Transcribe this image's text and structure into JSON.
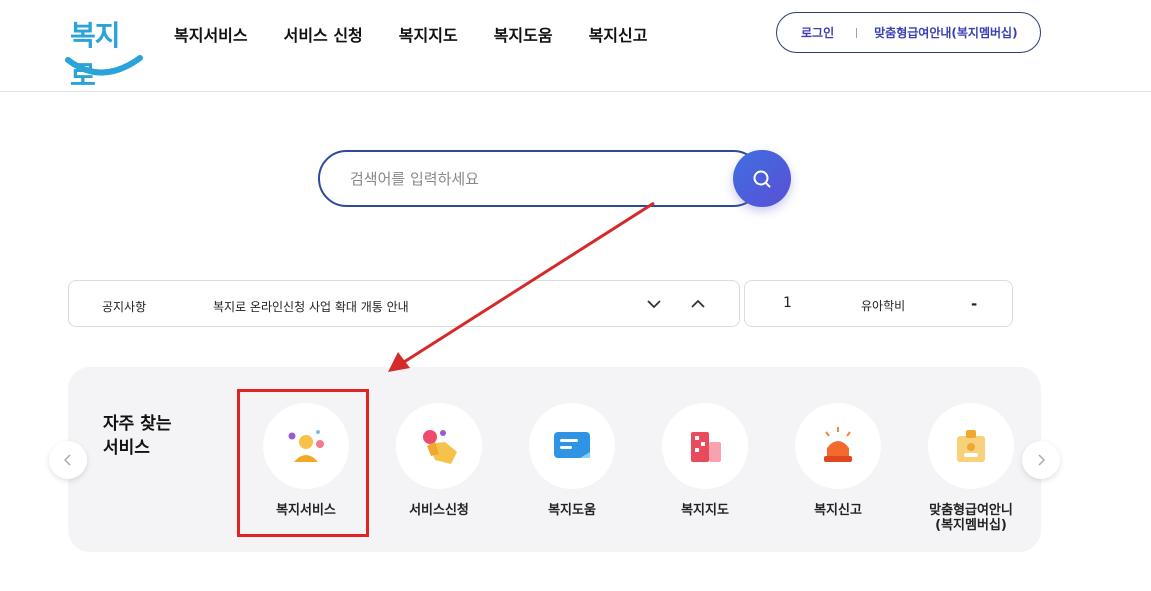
{
  "header": {
    "logo_text": "복지로",
    "nav": [
      "복지서비스",
      "서비스 신청",
      "복지지도",
      "복지도움",
      "복지신고"
    ],
    "login_label": "로그인",
    "member_label": "맞춤형급여안내(복지멤버십)"
  },
  "search": {
    "placeholder": "검색어를 입력하세요"
  },
  "notice": {
    "label": "공지사항",
    "text": "복지로 온라인신청 사업 확대 개통 안내"
  },
  "ranking": {
    "rank": "1",
    "term": "유아학비",
    "change": "-"
  },
  "frequent": {
    "title_line1": "자주 찾는",
    "title_line2": "서비스",
    "items": [
      {
        "label": "복지서비스",
        "icon": "person-icon"
      },
      {
        "label": "서비스신청",
        "icon": "hand-touch-icon"
      },
      {
        "label": "복지도움",
        "icon": "chat-bubble-icon"
      },
      {
        "label": "복지지도",
        "icon": "map-blocks-icon"
      },
      {
        "label": "복지신고",
        "icon": "siren-icon"
      },
      {
        "label_line1": "맞춤형급여안니",
        "label_line2": "(복지멤버십)",
        "icon": "id-badge-icon"
      }
    ]
  },
  "colors": {
    "accent": "#3b3fb6",
    "search_border": "#2e4a9a",
    "highlight": "#e02424",
    "logo": "#29a3d8"
  }
}
